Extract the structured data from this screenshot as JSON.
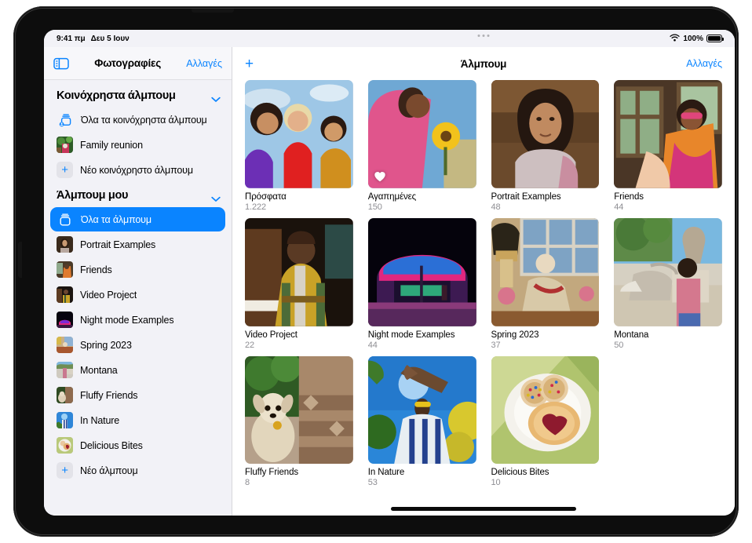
{
  "status_bar": {
    "time": "9:41 πμ",
    "date": "Δευ 5 Ιουν",
    "wifi_icon": "wifi-icon",
    "battery_percent": "100%",
    "battery_icon": "battery-full-icon"
  },
  "sidebar": {
    "toggle_icon": "sidebar-toggle-icon",
    "title": "Φωτογραφίες",
    "edit_label": "Αλλαγές",
    "sections": [
      {
        "header": "Κοινόχρηστα άλμπουμ",
        "chevron_icon": "chevron-down-icon",
        "items": [
          {
            "label": "Όλα τα κοινόχρηστα άλμπουμ",
            "icon": "shared-albums-icon",
            "type": "glyph",
            "selected": false
          },
          {
            "label": "Family reunion",
            "icon": "album-thumbnail",
            "type": "thumb",
            "thumb": "family",
            "selected": false
          },
          {
            "label": "Νέο κοινόχρηστο άλμπουμ",
            "icon": "plus-icon",
            "type": "plus",
            "selected": false
          }
        ]
      },
      {
        "header": "Άλμπουμ μου",
        "chevron_icon": "chevron-down-icon",
        "items": [
          {
            "label": "Όλα τα άλμπουμ",
            "icon": "albums-stack-icon",
            "type": "glyph",
            "selected": true
          },
          {
            "label": "Portrait Examples",
            "icon": "album-thumbnail",
            "type": "thumb",
            "thumb": "portrait",
            "selected": false
          },
          {
            "label": "Friends",
            "icon": "album-thumbnail",
            "type": "thumb",
            "thumb": "friends",
            "selected": false
          },
          {
            "label": "Video Project",
            "icon": "album-thumbnail",
            "type": "thumb",
            "thumb": "video",
            "selected": false
          },
          {
            "label": "Night mode Examples",
            "icon": "album-thumbnail",
            "type": "thumb",
            "thumb": "night",
            "selected": false
          },
          {
            "label": "Spring 2023",
            "icon": "album-thumbnail",
            "type": "thumb",
            "thumb": "spring",
            "selected": false
          },
          {
            "label": "Montana",
            "icon": "album-thumbnail",
            "type": "thumb",
            "thumb": "montana",
            "selected": false
          },
          {
            "label": "Fluffy Friends",
            "icon": "album-thumbnail",
            "type": "thumb",
            "thumb": "fluffy",
            "selected": false
          },
          {
            "label": "In Nature",
            "icon": "album-thumbnail",
            "type": "thumb",
            "thumb": "nature",
            "selected": false
          },
          {
            "label": "Delicious Bites",
            "icon": "album-thumbnail",
            "type": "thumb",
            "thumb": "bites",
            "selected": false
          },
          {
            "label": "Νέο άλμπουμ",
            "icon": "plus-icon",
            "type": "plus",
            "selected": false
          }
        ]
      }
    ]
  },
  "main": {
    "add_icon": "plus-icon",
    "title": "Άλμπουμ",
    "edit_label": "Αλλαγές",
    "albums": [
      {
        "name": "Πρόσφατα",
        "count": "1.222",
        "thumb": "recents",
        "favorite": false
      },
      {
        "name": "Αγαπημένες",
        "count": "150",
        "thumb": "favorites",
        "favorite": true
      },
      {
        "name": "Portrait Examples",
        "count": "48",
        "thumb": "portrait",
        "favorite": false
      },
      {
        "name": "Friends",
        "count": "44",
        "thumb": "friends",
        "favorite": false
      },
      {
        "name": "Video Project",
        "count": "22",
        "thumb": "video",
        "favorite": false
      },
      {
        "name": "Night mode Examples",
        "count": "44",
        "thumb": "night",
        "favorite": false
      },
      {
        "name": "Spring 2023",
        "count": "37",
        "thumb": "spring",
        "favorite": false
      },
      {
        "name": "Montana",
        "count": "50",
        "thumb": "montana",
        "favorite": false
      },
      {
        "name": "Fluffy Friends",
        "count": "8",
        "thumb": "fluffy",
        "favorite": false
      },
      {
        "name": "In Nature",
        "count": "53",
        "thumb": "nature",
        "favorite": false
      },
      {
        "name": "Delicious Bites",
        "count": "10",
        "thumb": "bites",
        "favorite": false
      }
    ]
  },
  "colors": {
    "accent": "#0a84ff",
    "sidebar_bg": "#f2f2f7",
    "secondary_text": "#8e8e93"
  }
}
